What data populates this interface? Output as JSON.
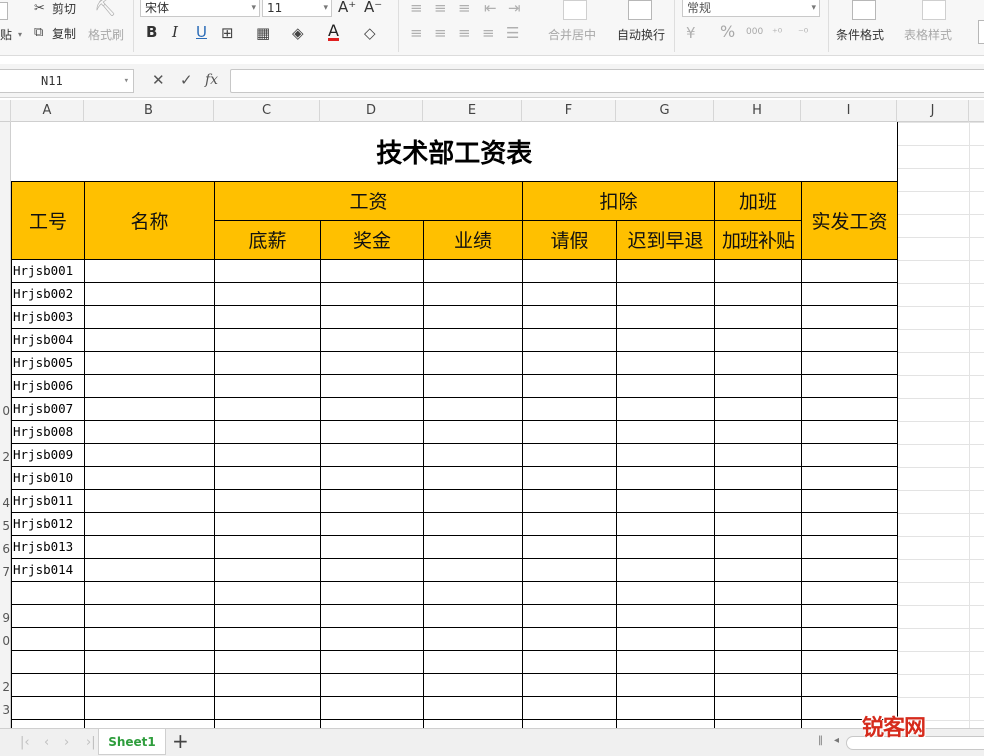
{
  "ribbon": {
    "clipboard": {
      "paste_fragment": "贴",
      "cut": "剪切",
      "copy": "复制",
      "format_painter": "格式刷"
    },
    "font": {
      "family": "宋体",
      "size": "11",
      "grow": "A⁺",
      "shrink": "A⁻",
      "bold": "B",
      "italic": "I",
      "underline": "U",
      "font_color_glyph": "A"
    },
    "alignment": {
      "merge_center": "合并居中",
      "wrap_text": "自动换行"
    },
    "number": {
      "format": "常规",
      "percent": "%",
      "thousands": "000"
    },
    "styles": {
      "conditional_format": "条件格式",
      "table_style": "表格样式"
    }
  },
  "formula_bar": {
    "name_box": "N11",
    "fx": "fx",
    "value": ""
  },
  "columns": [
    "A",
    "B",
    "C",
    "D",
    "E",
    "F",
    "G",
    "H",
    "I",
    "J"
  ],
  "row_numbers_visible": [
    "",
    "",
    "",
    "",
    "",
    "",
    "",
    "",
    "",
    "0",
    "",
    "2",
    "",
    "4",
    "5",
    "6",
    "7",
    "",
    "9",
    "0",
    "",
    "2",
    "3"
  ],
  "table": {
    "title": "技术部工资表",
    "headers": {
      "id": "工号",
      "name": "名称",
      "salary_group": "工资",
      "deduct_group": "扣除",
      "overtime_group": "加班",
      "net_pay": "实发工资",
      "base": "底薪",
      "bonus": "奖金",
      "performance": "业绩",
      "leave": "请假",
      "late_early": "迟到早退",
      "overtime_pay": "加班补贴"
    },
    "employee_ids": [
      "Hrjsb001",
      "Hrjsb002",
      "Hrjsb003",
      "Hrjsb004",
      "Hrjsb005",
      "Hrjsb006",
      "Hrjsb007",
      "Hrjsb008",
      "Hrjsb009",
      "Hrjsb010",
      "Hrjsb011",
      "Hrjsb012",
      "Hrjsb013",
      "Hrjsb014"
    ],
    "empty_rows": 7
  },
  "sheet_tabs": {
    "active": "Sheet1",
    "add": "+"
  },
  "watermark": "锐客网",
  "colors": {
    "header_fill": "#ffc000",
    "tab_text": "#2e9d3c",
    "watermark": "#d62b1c"
  }
}
